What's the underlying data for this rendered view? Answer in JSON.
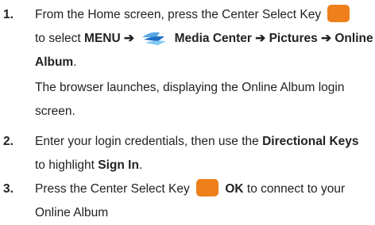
{
  "steps": [
    {
      "number": "1.",
      "line1_text": "From the Home screen, press the Center Select Key",
      "line2_pre": "to select ",
      "menu": "MENU",
      "arrow": "➔",
      "media_center": "Media Center",
      "pictures": "Pictures",
      "online": "Online",
      "album": "Album",
      "period": ".",
      "note_line1": "The browser launches, displaying the Online Album login",
      "note_line2": "screen."
    },
    {
      "number": "2.",
      "line1_pre": "Enter your login credentials, then use the ",
      "directional_keys": "Directional Keys",
      "line2_pre": "to highlight ",
      "sign_in": "Sign In",
      "period": "."
    },
    {
      "number": "3.",
      "line1_pre": "Press the Center Select Key",
      "ok": "OK",
      "line1_post": " to connect to your",
      "line2": "Online Album"
    }
  ],
  "colors": {
    "key": "#ee7f1a",
    "text": "#222222"
  },
  "icons": {
    "center_select_key": "center-select-key-icon",
    "media_center": "media-center-icon"
  }
}
